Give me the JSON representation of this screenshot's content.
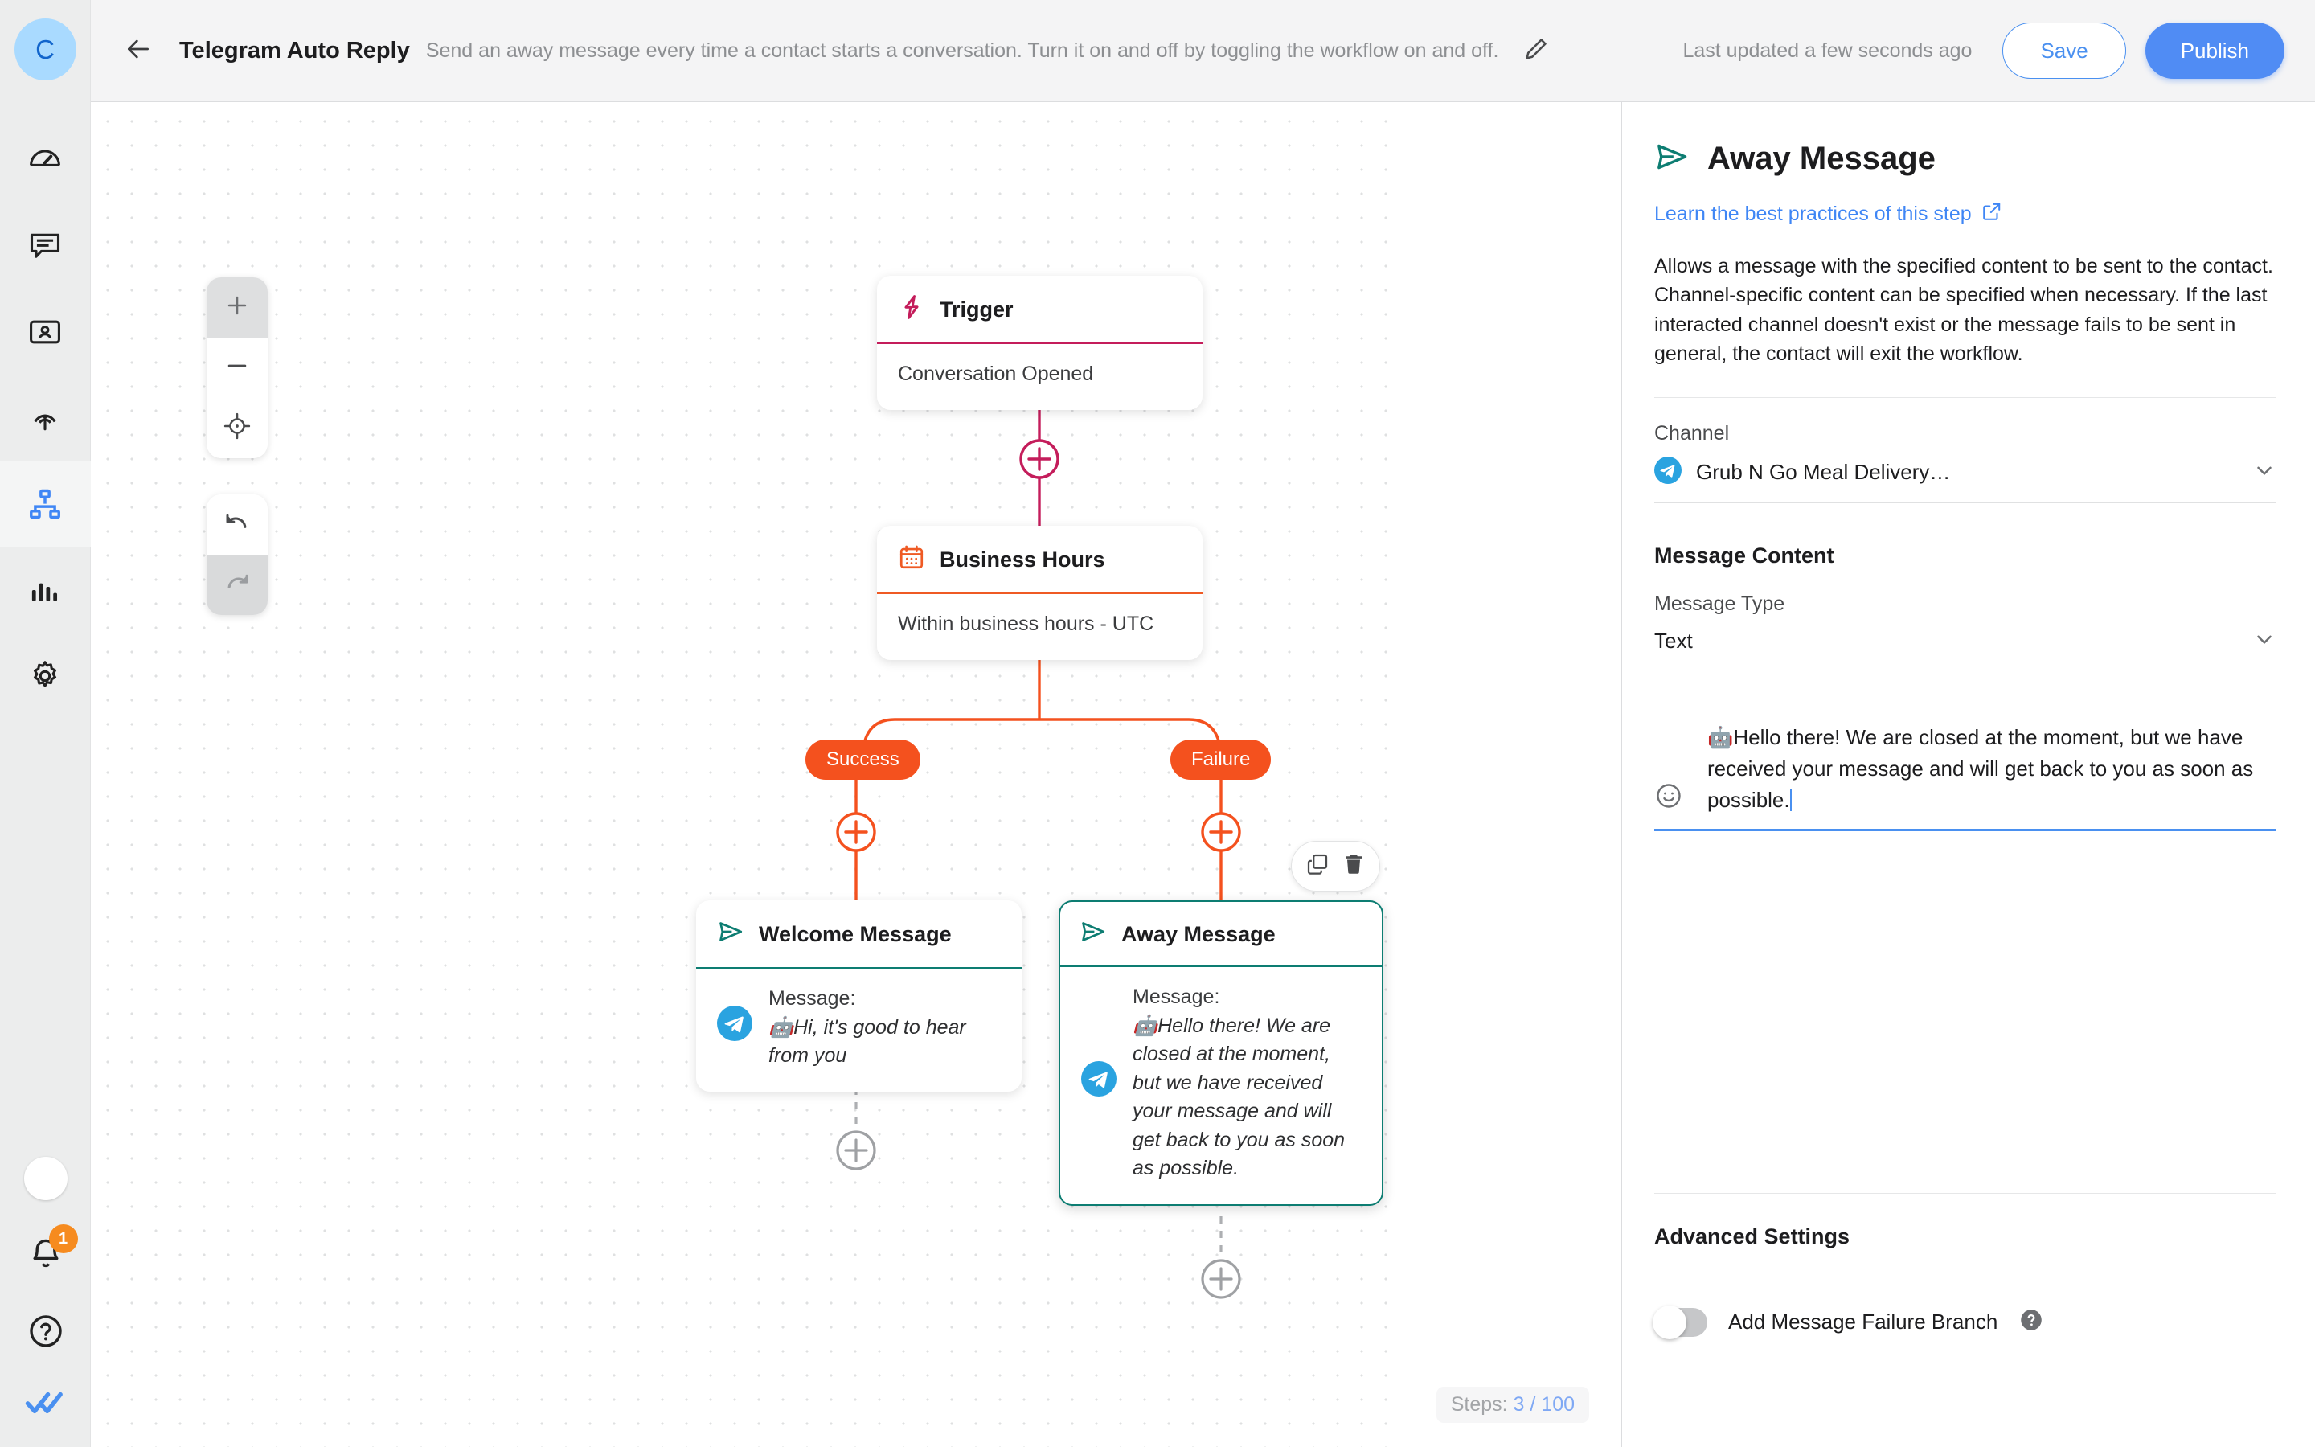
{
  "sidebar": {
    "avatar_initial": "C",
    "items": [
      {
        "name": "dashboard",
        "icon": "speedometer-icon",
        "active": false
      },
      {
        "name": "inbox",
        "icon": "chat-bubble-icon",
        "active": false
      },
      {
        "name": "contacts",
        "icon": "contact-card-icon",
        "active": false
      },
      {
        "name": "broadcast",
        "icon": "broadcast-icon",
        "active": false
      },
      {
        "name": "workflows",
        "icon": "workflow-icon",
        "active": true
      },
      {
        "name": "reports",
        "icon": "bar-chart-icon",
        "active": false
      },
      {
        "name": "settings",
        "icon": "gear-icon",
        "active": false
      }
    ],
    "notification_count": "1",
    "help_icon": "question-circle-icon",
    "logo_icon": "double-check-icon"
  },
  "header": {
    "back_icon": "arrow-left-icon",
    "title": "Telegram Auto Reply",
    "description": "Send an away message every time a contact starts a conversation. Turn it on and off by toggling the workflow on and off.",
    "edit_icon": "pencil-icon",
    "last_updated": "Last updated a few seconds ago",
    "save_label": "Save",
    "publish_label": "Publish"
  },
  "canvas": {
    "controls": {
      "zoom_in": "+",
      "zoom_out": "−",
      "recenter_icon": "crosshair-icon",
      "undo_icon": "undo-icon",
      "redo_icon": "redo-icon"
    },
    "node_toolbar": {
      "duplicate_icon": "copy-icon",
      "delete_icon": "trash-icon"
    },
    "steps_label": "Steps:",
    "steps_value": "3 / 100",
    "nodes": [
      {
        "id": "trigger",
        "icon": "lightning-icon",
        "title": "Trigger",
        "body": "Conversation Opened",
        "accent": "#c41d5b"
      },
      {
        "id": "business-hours",
        "icon": "calendar-icon",
        "title": "Business Hours",
        "body": "Within business hours - UTC",
        "accent": "#ef5a24"
      },
      {
        "id": "welcome-message",
        "icon": "send-icon",
        "title": "Welcome Message",
        "message_label": "Message:",
        "message_body": "🤖Hi, it's good to hear from you",
        "channel_icon": "telegram-icon",
        "accent": "#0d7d72"
      },
      {
        "id": "away-message",
        "icon": "send-icon",
        "title": "Away Message",
        "message_label": "Message:",
        "message_body": "🤖Hello there! We are closed at the moment, but we have received your message and will get back to you as soon as possible.",
        "channel_icon": "telegram-icon",
        "accent": "#0d7d72",
        "selected": true
      }
    ],
    "branches": [
      {
        "label": "Success",
        "color": "#f4511e"
      },
      {
        "label": "Failure",
        "color": "#f4511e"
      }
    ]
  },
  "panel": {
    "icon": "send-icon",
    "title": "Away Message",
    "learn_link": "Learn the best practices of this step",
    "learn_link_icon": "external-link-icon",
    "description": "Allows a message with the specified content to be sent to the contact. Channel-specific content can be specified when necessary. If the last interacted channel doesn't exist or the message fails to be sent in general, the contact will exit the workflow.",
    "channel_label": "Channel",
    "channel_value": "Grub N Go Meal Delivery…",
    "channel_icon": "telegram-icon",
    "message_content_label": "Message Content",
    "message_type_label": "Message Type",
    "message_type_value": "Text",
    "emoji_icon": "smiley-icon",
    "message_text": "🤖Hello there! We are closed at the moment, but we have received your message and will get back to you as soon as possible.",
    "advanced_title": "Advanced Settings",
    "failure_branch_label": "Add Message Failure Branch",
    "failure_branch_enabled": false,
    "help_icon": "question-circle-filled-icon"
  },
  "colors": {
    "accent_blue": "#508cf4",
    "trigger_pink": "#c41d5b",
    "branch_orange": "#f4511e",
    "message_teal": "#0d7d72",
    "telegram_blue": "#2aa3e0"
  }
}
